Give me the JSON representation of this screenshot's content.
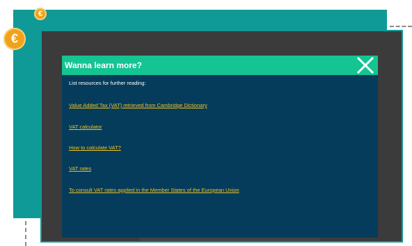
{
  "background": {
    "teal": "#0f9a98",
    "frame": "#3b3b3b"
  },
  "coins": {
    "symbol": "€",
    "color": "#f2a21a"
  },
  "modal": {
    "title": "Wanna learn more?",
    "header_color": "#14c493",
    "body_color": "#053c5b",
    "intro": "List resources for further reading:",
    "links": [
      "Value Added Tax (VAT) retrieved from Cambridge Dictionary",
      "VAT calculator",
      "How to calculate VAT?",
      "VAT rates",
      "To consult VAT rates applied in the Member States of the European Union"
    ],
    "link_color": "#f2c21e",
    "close_icon": "close-icon"
  }
}
